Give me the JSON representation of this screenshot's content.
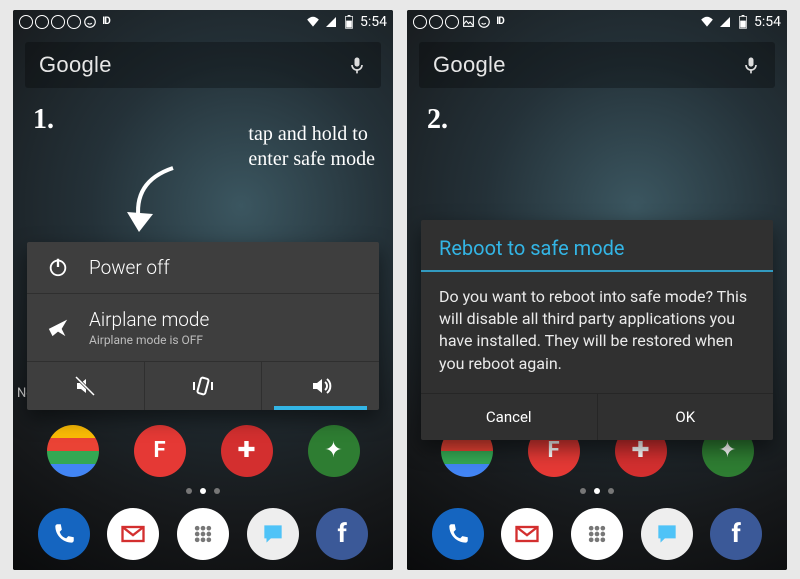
{
  "statusbar": {
    "time": "5:54"
  },
  "search": {
    "label": "Google"
  },
  "screen1": {
    "num": "1.",
    "hint": "tap and hold to\nenter safe mode",
    "power_off": "Power off",
    "airplane_title": "Airplane mode",
    "airplane_sub": "Airplane mode is OFF",
    "behind_label": "Ne"
  },
  "screen2": {
    "num": "2.",
    "title": "Reboot to safe mode",
    "body": "Do you want to reboot into safe mode? This will disable all third party applications you have installed. They will be restored when you reboot again.",
    "cancel": "Cancel",
    "ok": "OK"
  }
}
